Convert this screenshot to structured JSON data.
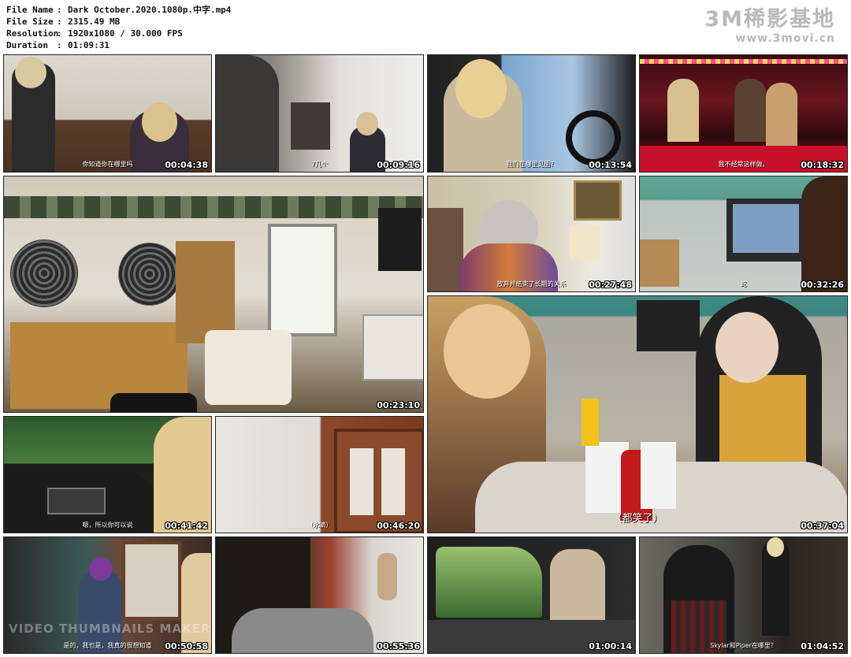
{
  "info": {
    "file_name_label": "File Name",
    "file_name": "Dark October.2020.1080p.中字.mp4",
    "file_size_label": "File Size",
    "file_size": "2315.49 MB",
    "resolution_label": "Resolution",
    "resolution": "1920x1080 / 30.000 FPS",
    "duration_label": "Duration",
    "duration": "01:09:31",
    "sep": ":"
  },
  "brand": {
    "title": "3M稀影基地",
    "url": "www.3movi.cn"
  },
  "thumbnails": [
    {
      "time": "00:04:38",
      "subtitle": "你知道你在哪里吗"
    },
    {
      "time": "00:09:16",
      "subtitle": "7几个"
    },
    {
      "time": "00:13:54",
      "subtitle": "我们在哪里见面？"
    },
    {
      "time": "00:18:32",
      "subtitle": "我不经常这样做。"
    },
    {
      "time": "00:23:10",
      "subtitle": ""
    },
    {
      "time": "00:27:48",
      "subtitle": "放弃并结束了长期的关系"
    },
    {
      "time": "00:32:26",
      "subtitle": "蛇"
    },
    {
      "time": "00:37:04",
      "subtitle": "（都笑了）"
    },
    {
      "time": "00:41:42",
      "subtitle": "嗯，所以你可以说"
    },
    {
      "time": "00:46:20",
      "subtitle": "（水滴）"
    },
    {
      "time": "00:50:58",
      "subtitle": "是的，我也是，我真的很想知道"
    },
    {
      "time": "00:55:36",
      "subtitle": ""
    },
    {
      "time": "01:00:14",
      "subtitle": ""
    },
    {
      "time": "01:04:52",
      "subtitle": "Skylar和Piper在哪里？"
    }
  ],
  "watermark": "VIDEO THUMBNAILS MAKER"
}
